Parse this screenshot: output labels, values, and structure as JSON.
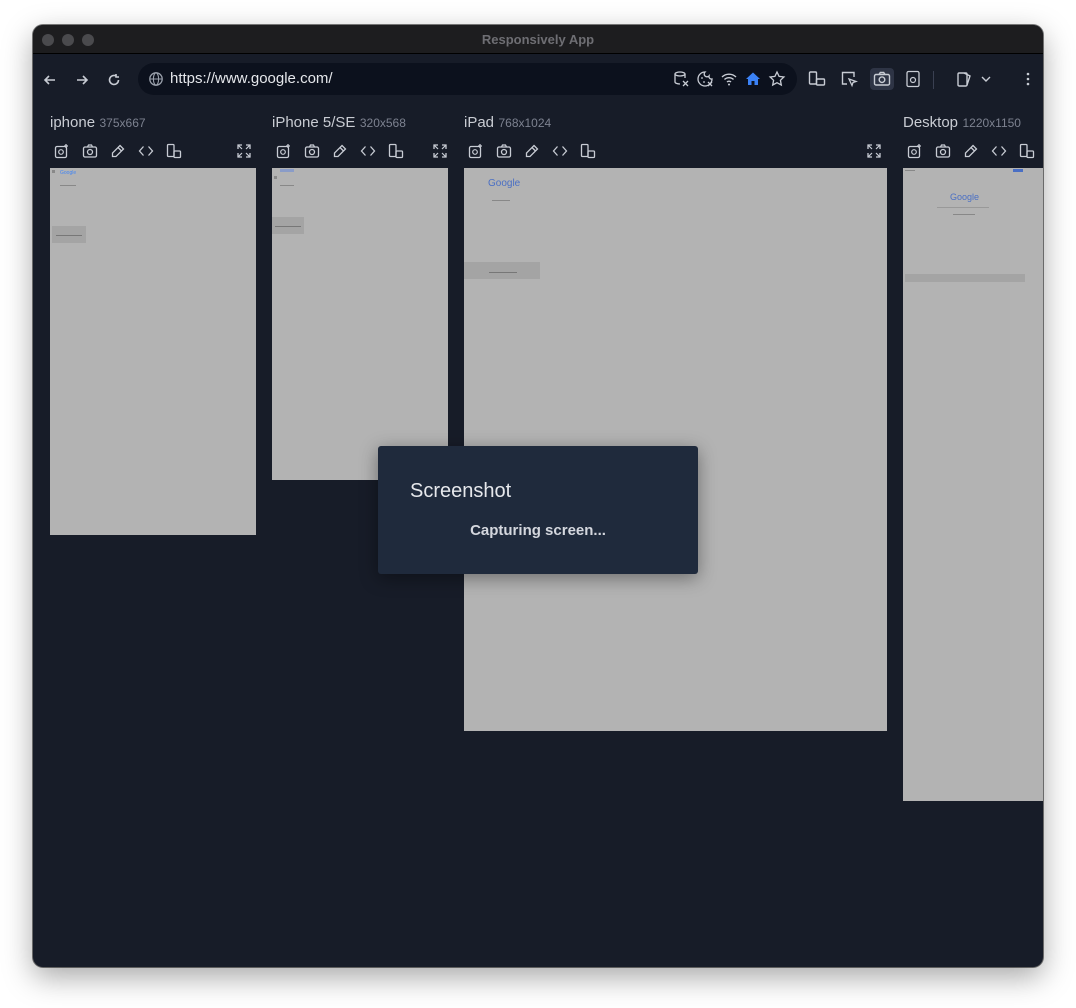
{
  "window": {
    "title": "Responsively App"
  },
  "toolbar": {
    "url": "https://www.google.com/"
  },
  "devices": [
    {
      "name": "iphone",
      "size": "375x667"
    },
    {
      "name": "iPhone 5/SE",
      "size": "320x568"
    },
    {
      "name": "iPad",
      "size": "768x1024"
    },
    {
      "name": "Desktop",
      "size": "1220x1150"
    }
  ],
  "preview": {
    "logo": "Google"
  },
  "modal": {
    "title": "Screenshot",
    "message": "Capturing screen..."
  },
  "colors": {
    "accent": "#3b82f6",
    "background": "#171c28",
    "frame": "#b3b3b3",
    "modal": "#1f2a3c"
  }
}
